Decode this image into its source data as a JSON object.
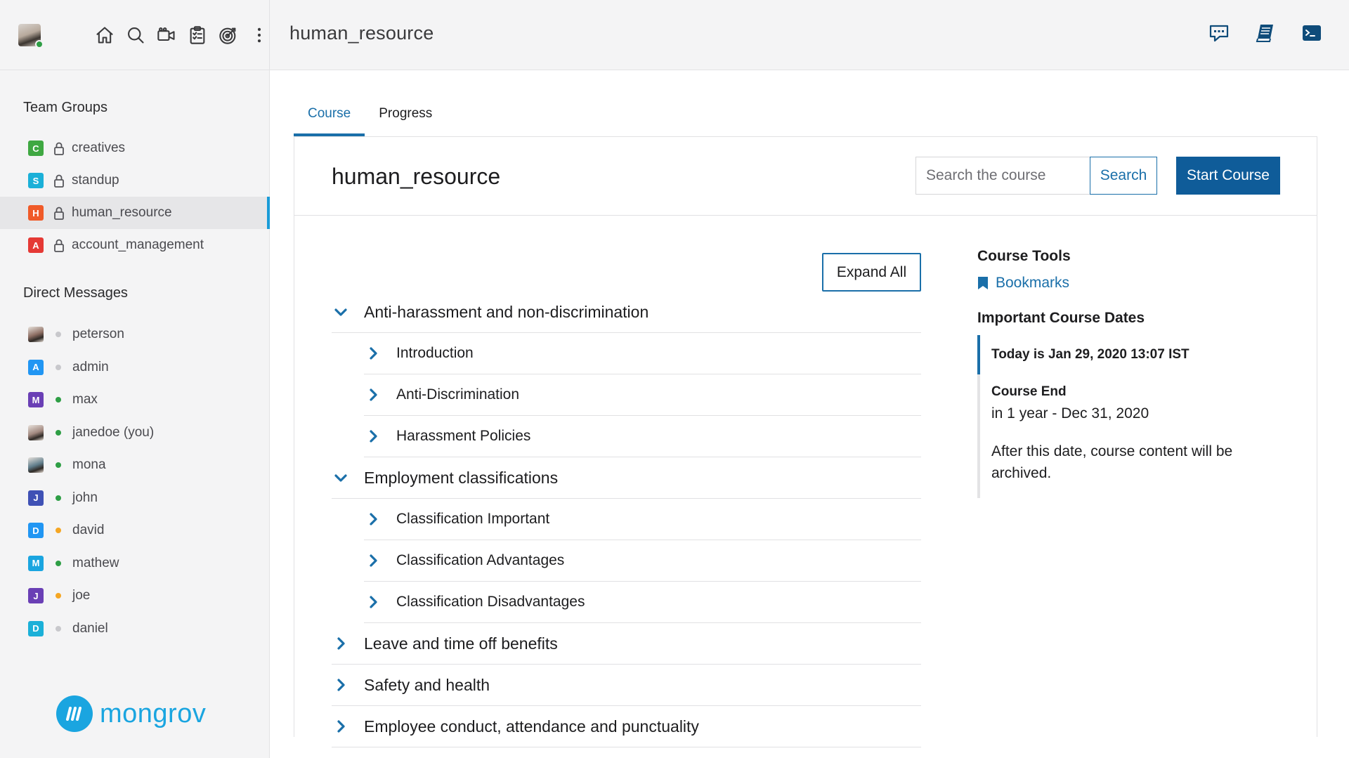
{
  "header": {
    "title": "human_resource",
    "nav_icons": [
      "home-icon",
      "search-icon",
      "video-icon",
      "clipboard-icon",
      "target-icon",
      "more-vertical-icon"
    ],
    "right_icons": [
      "chat-icon",
      "notebook-icon",
      "terminal-icon"
    ]
  },
  "sidebar": {
    "team_groups_title": "Team Groups",
    "groups": [
      {
        "initial": "C",
        "label": "creatives",
        "color": "#3fa842"
      },
      {
        "initial": "S",
        "label": "standup",
        "color": "#1bb0d8"
      },
      {
        "initial": "H",
        "label": "human_resource",
        "color": "#f05a28",
        "active": true
      },
      {
        "initial": "A",
        "label": "account_management",
        "color": "#e53935"
      }
    ],
    "direct_messages_title": "Direct Messages",
    "dms": [
      {
        "initial": "",
        "label": "peterson",
        "color": "#8d6e63",
        "status": "#c8c8cc",
        "photo": true
      },
      {
        "initial": "A",
        "label": "admin",
        "color": "#2196f3",
        "status": "#c8c8cc"
      },
      {
        "initial": "M",
        "label": "max",
        "color": "#6a3fb5",
        "status": "#2e9e45"
      },
      {
        "initial": "",
        "label": "janedoe (you)",
        "color": "#a1887f",
        "status": "#2e9e45",
        "photo": true
      },
      {
        "initial": "",
        "label": "mona",
        "color": "#607d8b",
        "status": "#2e9e45",
        "photo": true
      },
      {
        "initial": "J",
        "label": "john",
        "color": "#3f51b5",
        "status": "#2e9e45"
      },
      {
        "initial": "D",
        "label": "david",
        "color": "#2196f3",
        "status": "#f5a623"
      },
      {
        "initial": "M",
        "label": "mathew",
        "color": "#1aa5e0",
        "status": "#2e9e45"
      },
      {
        "initial": "J",
        "label": "joe",
        "color": "#6a3fb5",
        "status": "#f5a623"
      },
      {
        "initial": "D",
        "label": "daniel",
        "color": "#1bb0d8",
        "status": "#c8c8cc"
      }
    ],
    "logo_text": "mongrov"
  },
  "main": {
    "tabs": [
      {
        "label": "Course",
        "active": true
      },
      {
        "label": "Progress",
        "active": false
      }
    ],
    "course_title": "human_resource",
    "search_placeholder": "Search the course",
    "search_label": "Search",
    "start_label": "Start Course",
    "expand_label": "Expand All",
    "outline": [
      {
        "label": "Anti-harassment and non-discrimination",
        "expanded": true,
        "children": [
          "Introduction",
          "Anti-Discrimination",
          "Harassment Policies"
        ]
      },
      {
        "label": "Employment classifications",
        "expanded": true,
        "children": [
          "Classification Important",
          "Classification Advantages",
          "Classification Disadvantages"
        ]
      },
      {
        "label": "Leave and time off benefits",
        "expanded": false,
        "children": []
      },
      {
        "label": "Safety and health",
        "expanded": false,
        "children": []
      },
      {
        "label": "Employee conduct, attendance and punctuality",
        "expanded": false,
        "children": []
      }
    ],
    "tools": {
      "title": "Course Tools",
      "bookmarks": "Bookmarks",
      "dates_title": "Important Course Dates",
      "today": "Today is Jan 29, 2020 13:07 IST",
      "end_title": "Course End",
      "end_when": "in 1 year - Dec 31, 2020",
      "end_note": "After this date, course content will be archived."
    }
  },
  "colors": {
    "accent": "#1a6fa9",
    "primary_button": "#0f5c99",
    "active_indicator": "#1a9bd7"
  }
}
